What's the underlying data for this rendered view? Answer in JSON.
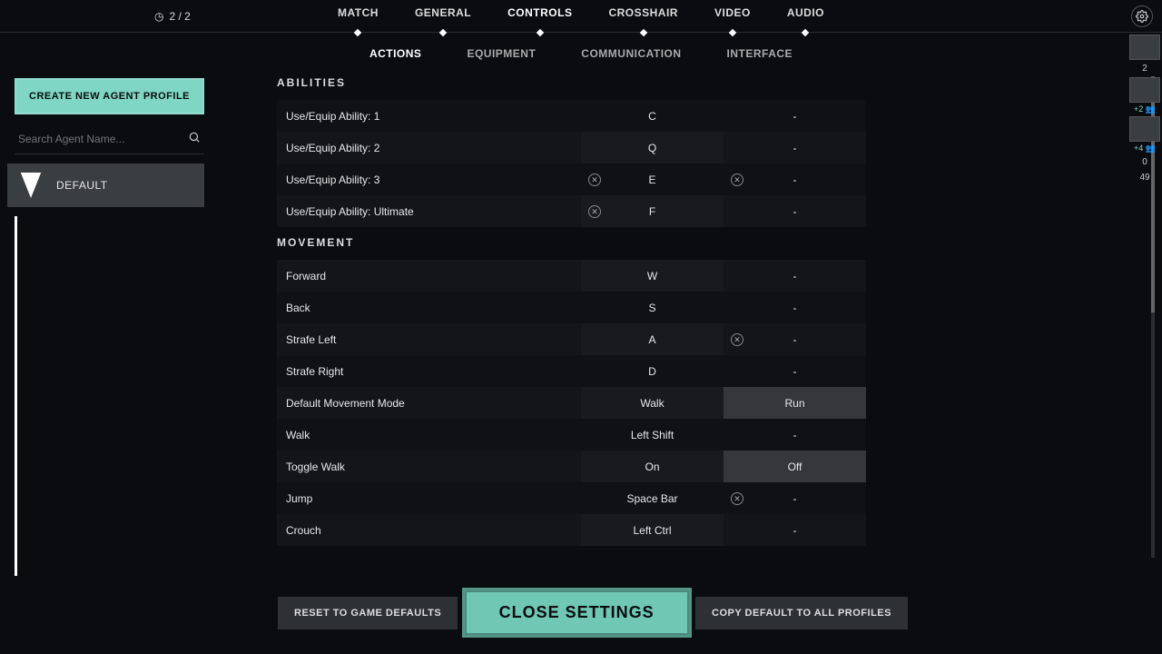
{
  "header": {
    "page_counter": "2 / 2",
    "main_tabs": [
      "MATCH",
      "GENERAL",
      "CONTROLS",
      "CROSSHAIR",
      "VIDEO",
      "AUDIO"
    ],
    "active_main": 2,
    "sub_tabs": [
      "ACTIONS",
      "EQUIPMENT",
      "COMMUNICATION",
      "INTERFACE"
    ],
    "active_sub": 0
  },
  "sidebar": {
    "create_label": "CREATE NEW AGENT PROFILE",
    "search_placeholder": "Search Agent Name...",
    "profiles": [
      {
        "label": "DEFAULT"
      }
    ]
  },
  "sections": [
    {
      "title": "ABILITIES",
      "rows": [
        {
          "label": "Use/Equip Ability: 1",
          "primary": "C",
          "secondary": "-",
          "clear_p": false,
          "clear_s": false
        },
        {
          "label": "Use/Equip Ability: 2",
          "primary": "Q",
          "secondary": "-",
          "clear_p": false,
          "clear_s": false
        },
        {
          "label": "Use/Equip Ability: 3",
          "primary": "E",
          "secondary": "-",
          "clear_p": true,
          "clear_s": true
        },
        {
          "label": "Use/Equip Ability: Ultimate",
          "primary": "F",
          "secondary": "-",
          "clear_p": true,
          "clear_s": false
        }
      ]
    },
    {
      "title": "MOVEMENT",
      "rows": [
        {
          "label": "Forward",
          "primary": "W",
          "secondary": "-",
          "clear_p": false,
          "clear_s": false
        },
        {
          "label": "Back",
          "primary": "S",
          "secondary": "-",
          "clear_p": false,
          "clear_s": false
        },
        {
          "label": "Strafe Left",
          "primary": "A",
          "secondary": "-",
          "clear_p": false,
          "clear_s": true
        },
        {
          "label": "Strafe Right",
          "primary": "D",
          "secondary": "-",
          "clear_p": false,
          "clear_s": false
        },
        {
          "label": "Default Movement Mode",
          "primary": "Walk",
          "secondary": "Run",
          "toggle": true,
          "selected": 1
        },
        {
          "label": "Walk",
          "primary": "Left Shift",
          "secondary": "-",
          "clear_p": false,
          "clear_s": false
        },
        {
          "label": "Toggle Walk",
          "primary": "On",
          "secondary": "Off",
          "toggle": true,
          "selected": 1
        },
        {
          "label": "Jump",
          "primary": "Space Bar",
          "secondary": "-",
          "clear_p": false,
          "clear_s": true
        },
        {
          "label": "Crouch",
          "primary": "Left Ctrl",
          "secondary": "-",
          "clear_p": false,
          "clear_s": false
        }
      ]
    }
  ],
  "footer": {
    "reset": "RESET TO GAME DEFAULTS",
    "close": "CLOSE SETTINGS",
    "copy": "COPY DEFAULT TO ALL PROFILES"
  },
  "right_panel": {
    "items": [
      {
        "count": "2",
        "badge": ""
      },
      {
        "count": "",
        "badge": "+2"
      },
      {
        "count": "",
        "badge": "+4"
      },
      {
        "count": "0",
        "badge": ""
      },
      {
        "count": "49",
        "badge": ""
      }
    ]
  }
}
